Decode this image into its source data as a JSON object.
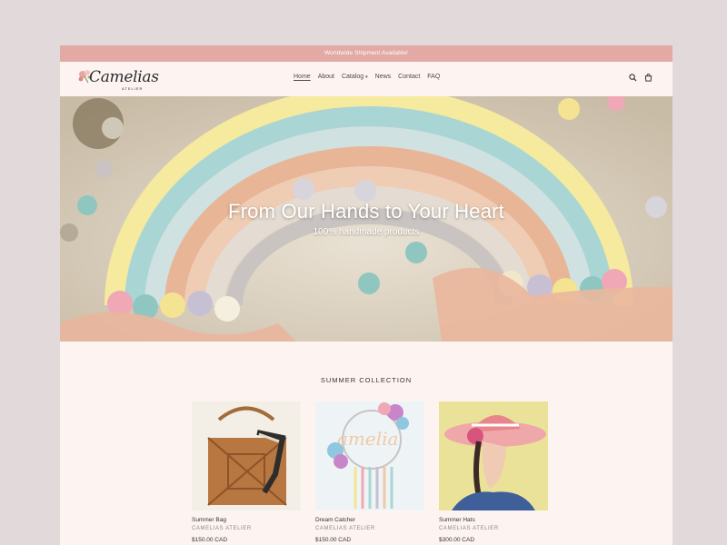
{
  "announcement": "Worldwide Shipment Available!",
  "brand": {
    "name": "Camelias",
    "sub": "ATELIER"
  },
  "nav": {
    "items": [
      {
        "label": "Home"
      },
      {
        "label": "About"
      },
      {
        "label": "Catalog"
      },
      {
        "label": "News"
      },
      {
        "label": "Contact"
      },
      {
        "label": "FAQ"
      }
    ]
  },
  "header_icons": [
    "search-icon",
    "cart-icon"
  ],
  "hero": {
    "title": "From Our Hands to Your Heart",
    "subtitle": "100% handmade products"
  },
  "collection": {
    "title": "SUMMER COLLECTION",
    "products": [
      {
        "name": "Summer Bag",
        "vendor": "CAMELIAS ATELIER",
        "price": "$150.00 CAD"
      },
      {
        "name": "Dream Catcher",
        "vendor": "CAMELIAS ATELIER",
        "price": "$150.00 CAD"
      },
      {
        "name": "Summer Hats",
        "vendor": "CAMELIAS ATELIER",
        "price": "$300.00 CAD"
      }
    ]
  },
  "colors": {
    "announcement_bg": "#e3a9a4",
    "page_bg": "#fdf4f2",
    "outer_bg": "#e2d9da"
  }
}
